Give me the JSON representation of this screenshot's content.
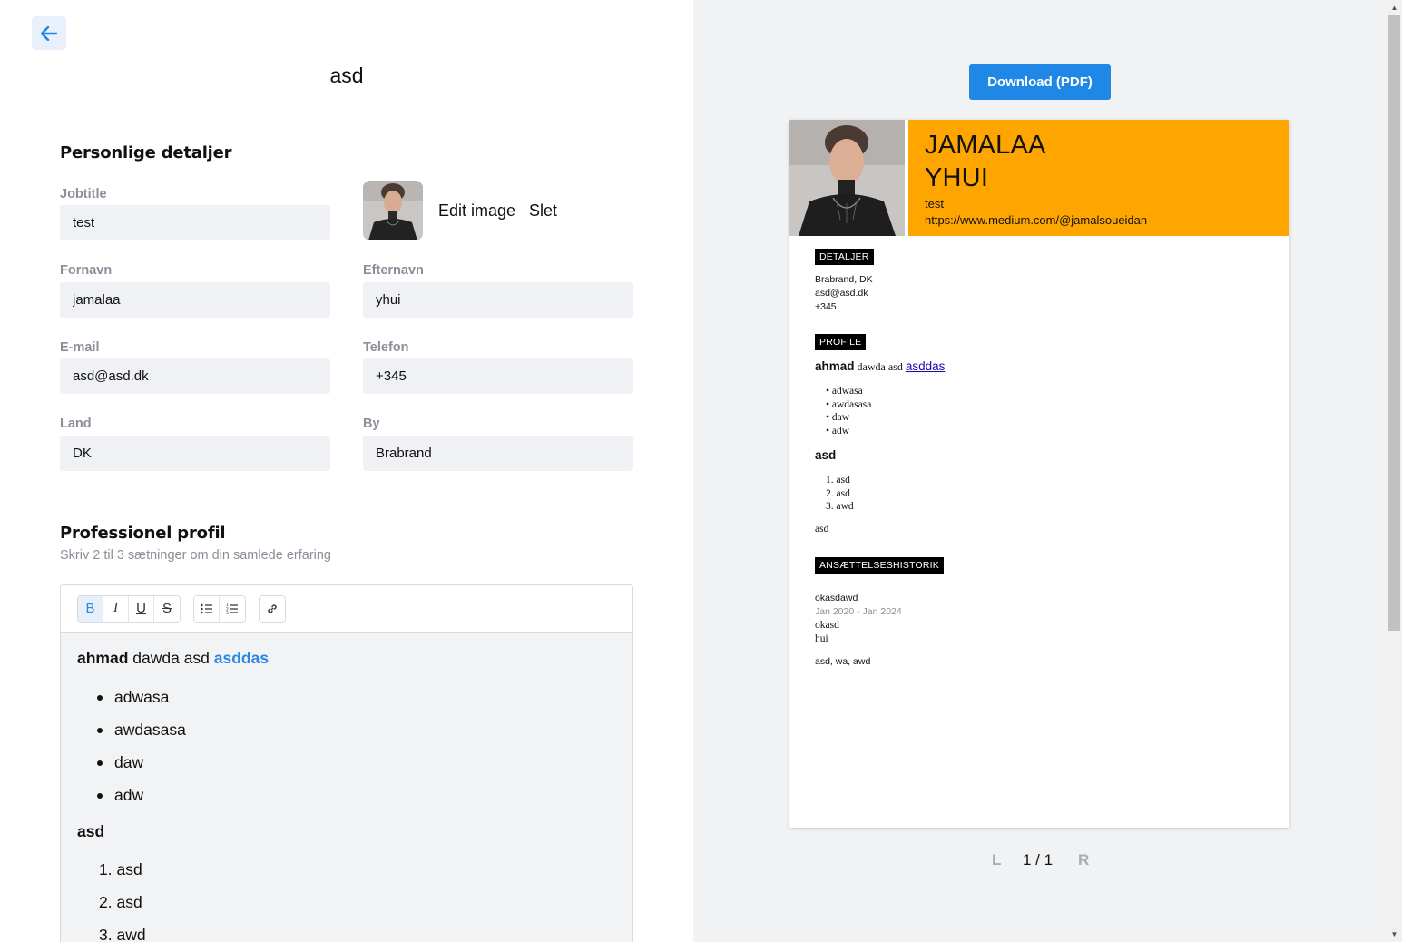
{
  "editor": {
    "title": "asd",
    "personal": {
      "heading": "Personlige detaljer",
      "jobtitle": {
        "label": "Jobtitle",
        "value": "test"
      },
      "image_actions": {
        "edit": "Edit image",
        "delete": "Slet"
      },
      "firstname": {
        "label": "Fornavn",
        "value": "jamalaa"
      },
      "lastname": {
        "label": "Efternavn",
        "value": "yhui"
      },
      "email": {
        "label": "E-mail",
        "value": "asd@asd.dk"
      },
      "phone": {
        "label": "Telefon",
        "value": "+345"
      },
      "country": {
        "label": "Land",
        "value": "DK"
      },
      "city": {
        "label": "By",
        "value": "Brabrand"
      }
    },
    "profile": {
      "heading": "Professionel profil",
      "subheading": "Skriv 2 til 3 sætninger om din samlede erfaring",
      "toolbar": {
        "bold": "B",
        "italic": "I",
        "underline": "U",
        "strike": "S",
        "bullet_list_icon": "bullet-list-icon",
        "ordered_list_icon": "ordered-list-icon",
        "link_icon": "link-icon"
      },
      "content": {
        "bold_word": "ahmad",
        "text": " dawda asd ",
        "link": "asddas",
        "bullets": [
          "adwasa",
          "awdasasa",
          "daw",
          "adw"
        ],
        "heading2": "asd",
        "numbered": [
          "1. asd",
          "2. asd",
          "3. awd"
        ]
      }
    }
  },
  "preview": {
    "download_label": "Download (PDF)",
    "cv": {
      "first_name": "JAMALAA",
      "last_name": "YHUI",
      "jobtitle": "test",
      "url": "https://www.medium.com/@jamalsoueidan",
      "details_tag": "DETALJER",
      "details": [
        "Brabrand, DK",
        "asd@asd.dk",
        "+345"
      ],
      "profile_tag": "PROFILE",
      "profile_bold": "ahmad",
      "profile_text": " dawda asd ",
      "profile_link": "asddas",
      "bullets": [
        "• adwasa",
        "• awdasasa",
        "• daw",
        "• adw"
      ],
      "heading2": "asd",
      "numbered": [
        "1. asd",
        "2. asd",
        "3. awd"
      ],
      "trailing": "asd",
      "history_tag": "ANSÆTTELSESHISTORIK",
      "job_title": "okasdawd",
      "job_dates": "Jan 2020 - Jan 2024",
      "job_lines": [
        "okasd",
        "hui"
      ],
      "skills": "asd, wa, awd"
    },
    "pager": {
      "prev": "L",
      "page": "1 / 1",
      "next": "R"
    }
  },
  "colors": {
    "accent": "#1f87e5",
    "cv_header": "#ffa500",
    "field_bg": "#eff1f4",
    "preview_bg": "#f1f2f4"
  }
}
